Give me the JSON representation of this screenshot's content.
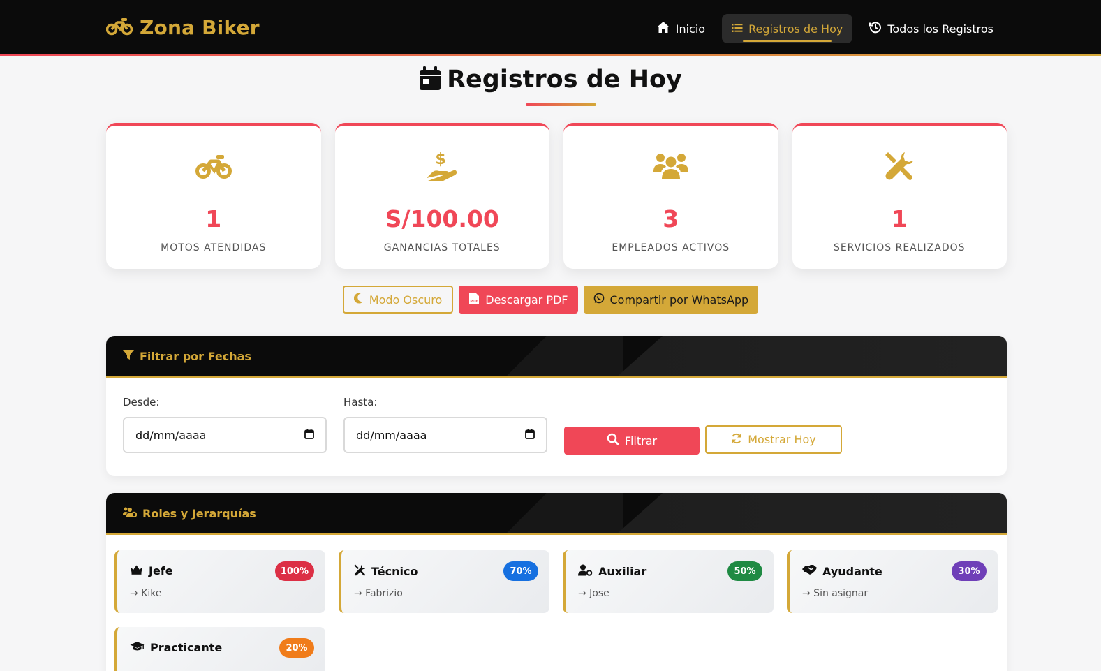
{
  "brand": {
    "name": "Zona Biker"
  },
  "nav": {
    "items": [
      {
        "label": "Inicio",
        "icon": "home-icon"
      },
      {
        "label": "Registros de Hoy",
        "icon": "list-icon",
        "active": true
      },
      {
        "label": "Todos los Registros",
        "icon": "history-icon"
      }
    ]
  },
  "page": {
    "title": "Registros de Hoy"
  },
  "stats": [
    {
      "value": "1",
      "label": "Motos Atendidas",
      "icon": "motorcycle-icon"
    },
    {
      "value": "S/100.00",
      "label": "Ganancias Totales",
      "icon": "hand-dollar-icon"
    },
    {
      "value": "3",
      "label": "Empleados Activos",
      "icon": "users-icon"
    },
    {
      "value": "1",
      "label": "Servicios Realizados",
      "icon": "tools-icon"
    }
  ],
  "actions": {
    "dark_mode": "Modo Oscuro",
    "download_pdf": "Descargar PDF",
    "share_whatsapp": "Compartir por WhatsApp"
  },
  "filter": {
    "title": "Filtrar por Fechas",
    "from_label": "Desde:",
    "from_value": "dd/mm/aaaa",
    "to_label": "Hasta:",
    "to_value": "dd/mm/aaaa",
    "filter_button": "Filtrar",
    "today_button": "Mostrar Hoy"
  },
  "roles": {
    "title": "Roles y Jerarquías",
    "items": [
      {
        "role": "Jefe",
        "percent": "100%",
        "person": "→ Kike",
        "color": "#dc2f45",
        "icon": "crown-icon"
      },
      {
        "role": "Técnico",
        "percent": "70%",
        "person": "→ Fabrizio",
        "color": "#1670e0",
        "icon": "tools-icon"
      },
      {
        "role": "Auxiliar",
        "percent": "50%",
        "person": "→ Jose",
        "color": "#1f8a43",
        "icon": "user-gear-icon"
      },
      {
        "role": "Ayudante",
        "percent": "30%",
        "person": "→ Sin asignar",
        "color": "#6f3fb8",
        "icon": "handshake-icon"
      },
      {
        "role": "Practicante",
        "percent": "20%",
        "person": "",
        "color": "#f07c1a",
        "icon": "graduation-cap-icon"
      }
    ]
  },
  "colors": {
    "accent_red": "#f04757",
    "accent_gold": "#d4a838",
    "dark": "#0b0b0b"
  }
}
